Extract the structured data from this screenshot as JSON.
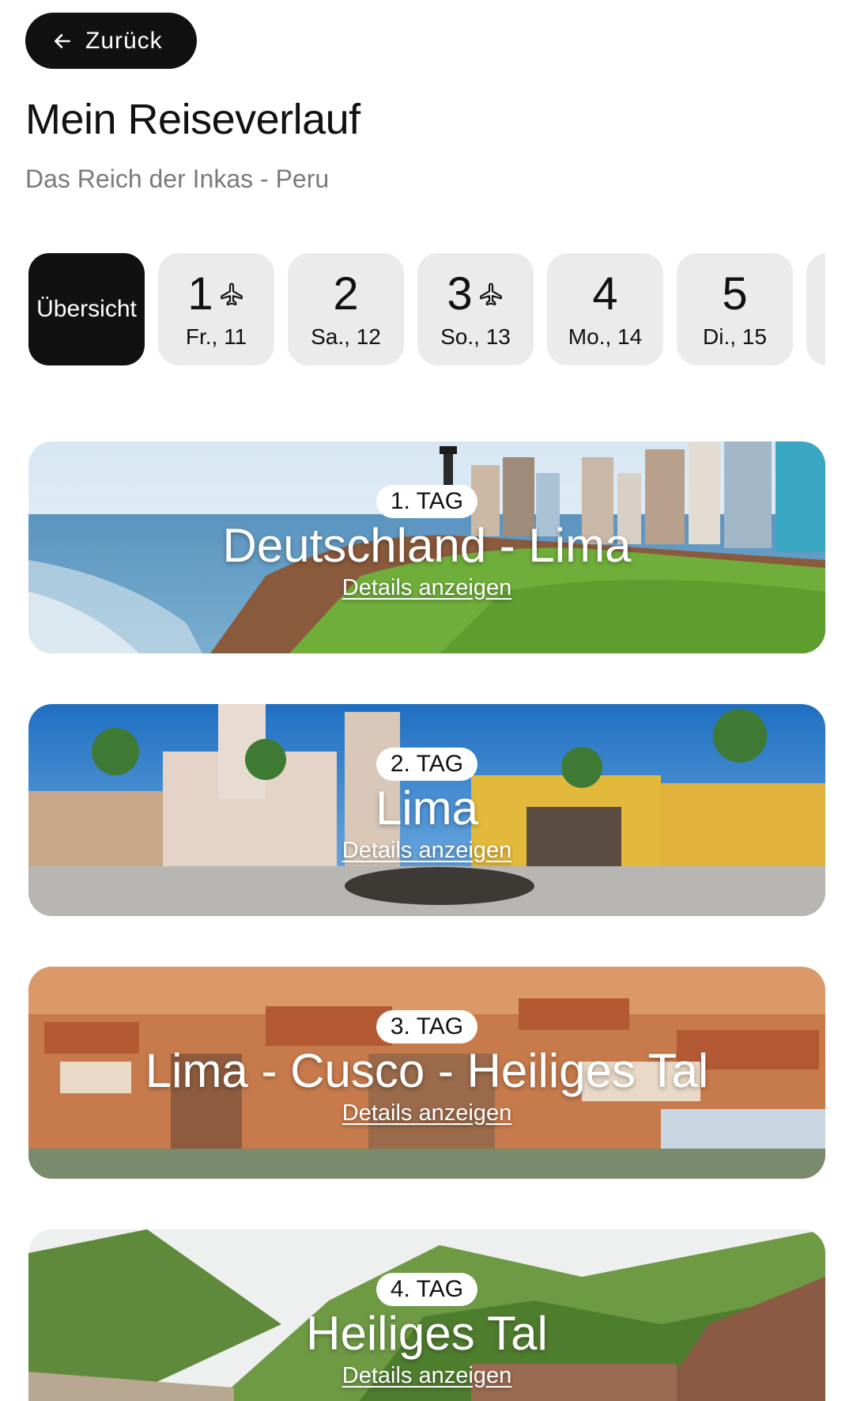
{
  "header": {
    "back_label": "Zurück",
    "title": "Mein Reiseverlauf",
    "subtitle": "Das Reich der Inkas - Peru"
  },
  "day_tabs": [
    {
      "label": "Übersicht",
      "active": true
    },
    {
      "number": "1",
      "date": "Fr., 11",
      "flight": true
    },
    {
      "number": "2",
      "date": "Sa., 12",
      "flight": false
    },
    {
      "number": "3",
      "date": "So., 13",
      "flight": true
    },
    {
      "number": "4",
      "date": "Mo., 14",
      "flight": false
    },
    {
      "number": "5",
      "date": "Di., 15",
      "flight": false
    }
  ],
  "days": [
    {
      "tag": "1. TAG",
      "title": "Deutschland - Lima",
      "link": "Details anzeigen"
    },
    {
      "tag": "2. TAG",
      "title": "Lima",
      "link": "Details anzeigen"
    },
    {
      "tag": "3. TAG",
      "title": "Lima - Cusco - Heiliges Tal",
      "link": "Details anzeigen"
    },
    {
      "tag": "4. TAG",
      "title": "Heiliges Tal",
      "link": "Details anzeigen"
    }
  ],
  "colors": {
    "active_chip": "#111111",
    "chip": "#ebebeb",
    "subtitle": "#7a7a7a"
  }
}
